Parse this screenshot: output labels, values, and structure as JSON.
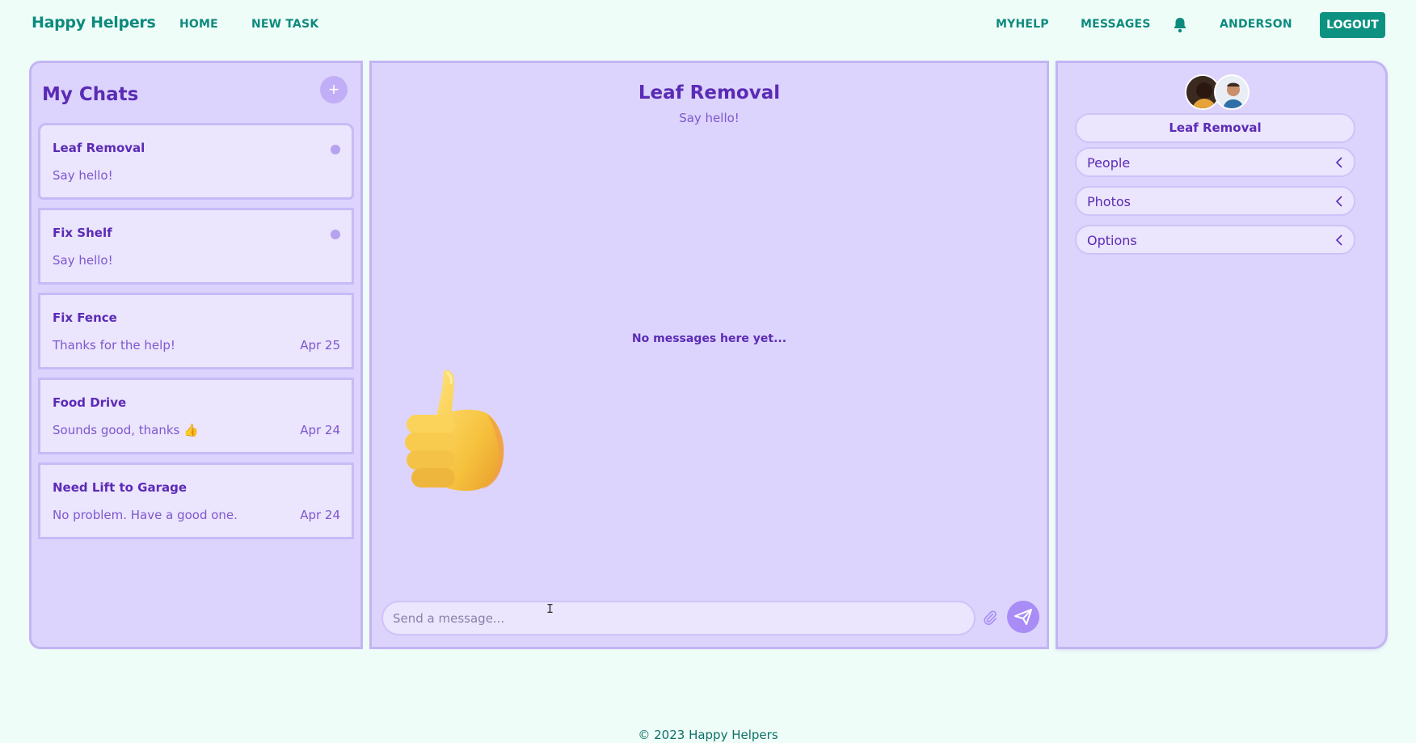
{
  "nav": {
    "brand": "Happy Helpers",
    "home": "HOME",
    "new_task": "NEW TASK",
    "myhelp": "MYHELP",
    "messages": "MESSAGES",
    "user": "ANDERSON",
    "logout": "LOGOUT",
    "bell_icon": "bell-icon"
  },
  "chats": {
    "title": "My Chats",
    "add_icon": "plus-icon",
    "items": [
      {
        "name": "Leaf Removal",
        "preview": "Say hello!",
        "date": "",
        "unread": true
      },
      {
        "name": "Fix Shelf",
        "preview": "Say hello!",
        "date": "",
        "unread": true
      },
      {
        "name": "Fix Fence",
        "preview": "Thanks for the help!",
        "date": "Apr 25",
        "unread": false
      },
      {
        "name": "Food Drive",
        "preview": "Sounds good, thanks 👍",
        "date": "Apr 24",
        "unread": false
      },
      {
        "name": "Need Lift to Garage",
        "preview": "No problem. Have a good one.",
        "date": "Apr 24",
        "unread": false
      }
    ]
  },
  "conversation": {
    "title": "Leaf Removal",
    "subtitle": "Say hello!",
    "empty_note": "No messages here yet...",
    "input_placeholder": "Send a message...",
    "attach_icon": "paperclip-icon",
    "send_icon": "send-icon"
  },
  "details": {
    "title": "Leaf Removal",
    "sections": [
      {
        "label": "People",
        "icon": "chevron-left-icon"
      },
      {
        "label": "Photos",
        "icon": "chevron-left-icon"
      },
      {
        "label": "Options",
        "icon": "chevron-left-icon"
      }
    ]
  },
  "footer": "© 2023 Happy Helpers",
  "colors": {
    "background": "#effdf8",
    "brand": "#0d8a7e",
    "panel": "#dcd4fc",
    "accent": "#5b2bb5",
    "logout": "#0d9282"
  }
}
